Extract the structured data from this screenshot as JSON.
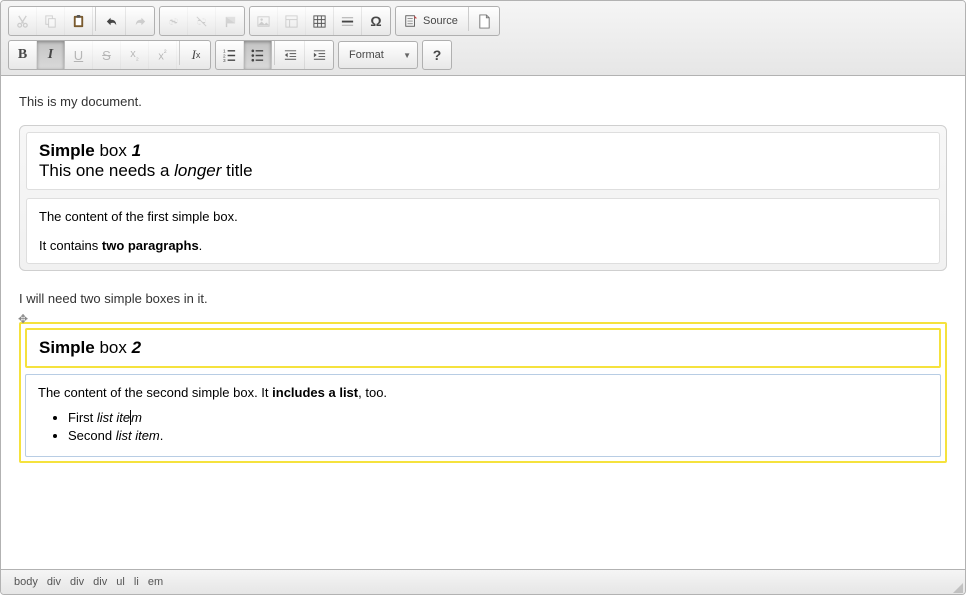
{
  "toolbar": {
    "source_label": "Source",
    "format_label": "Format"
  },
  "content": {
    "intro1": "This is my document.",
    "box1": {
      "title_l1_a": "Simple",
      "title_l1_b": " box ",
      "title_l1_c": "1",
      "title_l2_a": "This one needs a ",
      "title_l2_b": "longer",
      "title_l2_c": " title",
      "p1": "The content of the first simple box.",
      "p2a": "It contains ",
      "p2b": "two paragraphs",
      "p2c": "."
    },
    "intro2": "I will need two simple boxes in it.",
    "box2": {
      "title_a": "Simple",
      "title_b": " box ",
      "title_c": "2",
      "p1a": "The content of the second simple box. It ",
      "p1b": "includes a list",
      "p1c": ", too.",
      "li1a": "First ",
      "li1b": "list ite",
      "li1c": "m",
      "li2a": "Second ",
      "li2b": "list item",
      "li2c": "."
    }
  },
  "status_path": [
    "body",
    "div",
    "div",
    "div",
    "ul",
    "li",
    "em"
  ]
}
